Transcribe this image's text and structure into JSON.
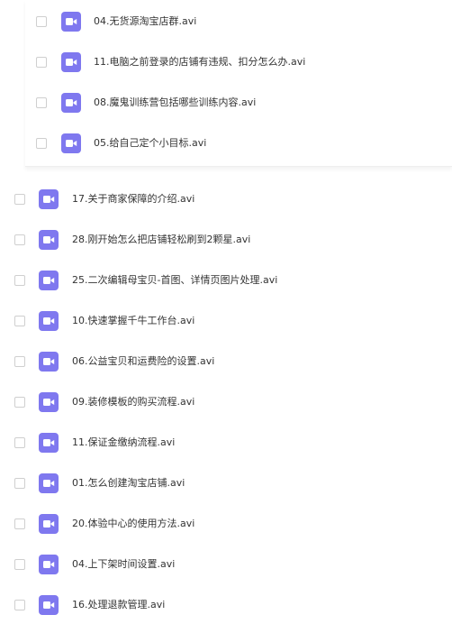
{
  "nested_list": {
    "items": [
      {
        "name": "04.无货源淘宝店群.avi",
        "icon": "video-file-icon"
      },
      {
        "name": "11.电脑之前登录的店铺有违规、扣分怎么办.avi",
        "icon": "video-file-icon"
      },
      {
        "name": "08.魔鬼训练营包括哪些训练内容.avi",
        "icon": "video-file-icon"
      },
      {
        "name": "05.给自己定个小目标.avi",
        "icon": "video-file-icon"
      }
    ]
  },
  "file_list": {
    "items": [
      {
        "name": "17.关于商家保障的介绍.avi",
        "icon": "video-file-icon"
      },
      {
        "name": "28.刚开始怎么把店铺轻松刷到2颗星.avi",
        "icon": "video-file-icon"
      },
      {
        "name": "25.二次编辑母宝贝-首图、详情页图片处理.avi",
        "icon": "video-file-icon"
      },
      {
        "name": "10.快速掌握千牛工作台.avi",
        "icon": "video-file-icon"
      },
      {
        "name": "06.公益宝贝和运费险的设置.avi",
        "icon": "video-file-icon"
      },
      {
        "name": "09.装修模板的购买流程.avi",
        "icon": "video-file-icon"
      },
      {
        "name": "11.保证金缴纳流程.avi",
        "icon": "video-file-icon"
      },
      {
        "name": "01.怎么创建淘宝店铺.avi",
        "icon": "video-file-icon"
      },
      {
        "name": "20.体验中心的使用方法.avi",
        "icon": "video-file-icon"
      },
      {
        "name": "04.上下架时间设置.avi",
        "icon": "video-file-icon"
      },
      {
        "name": "16.处理退款管理.avi",
        "icon": "video-file-icon"
      }
    ]
  },
  "colors": {
    "icon_bg": "#7f78ef",
    "text": "#333333",
    "checkbox_border": "#cfcfcf"
  }
}
